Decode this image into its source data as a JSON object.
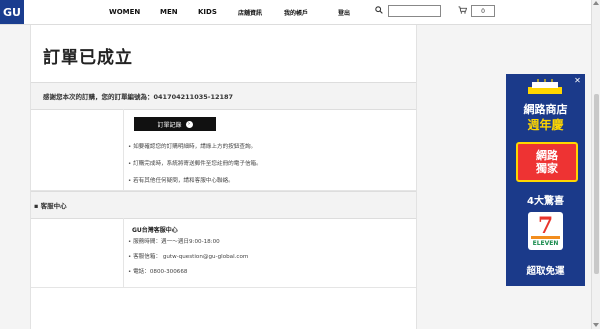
{
  "header": {
    "logo": "GU",
    "nav": [
      "WOMEN",
      "MEN",
      "KIDS",
      "店舖資訊",
      "我的帳戶",
      "登出"
    ],
    "cart_count": "0"
  },
  "main": {
    "title": "訂單已成立",
    "thanks_text": "感謝您本次的訂購，您的訂單編號為：041704211035-12187",
    "history_button": "訂單記錄",
    "notes": [
      "如要確認您的訂購明細時，請綠上方的按鈕查詢。",
      "訂購完成時，系統將寄送郵件至您註冊的電子信箱。",
      "若有其他任何疑問，請和客服中心聯絡。"
    ],
    "service_section": "客服中心",
    "service_title": "GU台灣客服中心",
    "service_lines": [
      "服務時間：週一～週日9:00-18:00",
      "客服信箱： gutw-question@gu-global.com",
      "電話：0800-300668"
    ]
  },
  "ad": {
    "line1": "網路商店",
    "line2": "週年慶",
    "box_line1": "網路",
    "box_line2": "獨家",
    "line3": "4大驚喜",
    "store_number": "7",
    "store_name": "ELEVEN",
    "line4": "超取免運",
    "colors": {
      "bg": "#1b3a8a",
      "accent": "#ffd600",
      "red": "#e33"
    }
  },
  "icons": [
    "search-icon",
    "cart-icon",
    "arrow-right-icon",
    "close-icon"
  ]
}
